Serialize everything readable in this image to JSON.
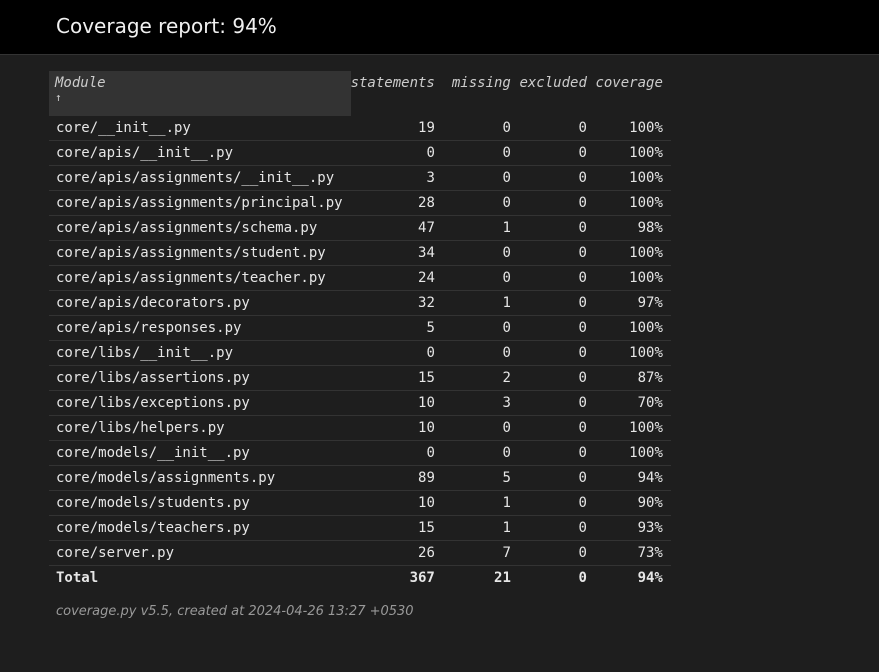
{
  "header": {
    "title": "Coverage report: 94%"
  },
  "table": {
    "columns": {
      "module": "Module",
      "sort_indicator": "↑",
      "statements": "statements",
      "missing": "missing",
      "excluded": "excluded",
      "coverage": "coverage"
    },
    "rows": [
      {
        "module": "core/__init__.py",
        "statements": "19",
        "missing": "0",
        "excluded": "0",
        "coverage": "100%"
      },
      {
        "module": "core/apis/__init__.py",
        "statements": "0",
        "missing": "0",
        "excluded": "0",
        "coverage": "100%"
      },
      {
        "module": "core/apis/assignments/__init__.py",
        "statements": "3",
        "missing": "0",
        "excluded": "0",
        "coverage": "100%"
      },
      {
        "module": "core/apis/assignments/principal.py",
        "statements": "28",
        "missing": "0",
        "excluded": "0",
        "coverage": "100%"
      },
      {
        "module": "core/apis/assignments/schema.py",
        "statements": "47",
        "missing": "1",
        "excluded": "0",
        "coverage": "98%"
      },
      {
        "module": "core/apis/assignments/student.py",
        "statements": "34",
        "missing": "0",
        "excluded": "0",
        "coverage": "100%"
      },
      {
        "module": "core/apis/assignments/teacher.py",
        "statements": "24",
        "missing": "0",
        "excluded": "0",
        "coverage": "100%"
      },
      {
        "module": "core/apis/decorators.py",
        "statements": "32",
        "missing": "1",
        "excluded": "0",
        "coverage": "97%"
      },
      {
        "module": "core/apis/responses.py",
        "statements": "5",
        "missing": "0",
        "excluded": "0",
        "coverage": "100%"
      },
      {
        "module": "core/libs/__init__.py",
        "statements": "0",
        "missing": "0",
        "excluded": "0",
        "coverage": "100%"
      },
      {
        "module": "core/libs/assertions.py",
        "statements": "15",
        "missing": "2",
        "excluded": "0",
        "coverage": "87%"
      },
      {
        "module": "core/libs/exceptions.py",
        "statements": "10",
        "missing": "3",
        "excluded": "0",
        "coverage": "70%"
      },
      {
        "module": "core/libs/helpers.py",
        "statements": "10",
        "missing": "0",
        "excluded": "0",
        "coverage": "100%"
      },
      {
        "module": "core/models/__init__.py",
        "statements": "0",
        "missing": "0",
        "excluded": "0",
        "coverage": "100%"
      },
      {
        "module": "core/models/assignments.py",
        "statements": "89",
        "missing": "5",
        "excluded": "0",
        "coverage": "94%"
      },
      {
        "module": "core/models/students.py",
        "statements": "10",
        "missing": "1",
        "excluded": "0",
        "coverage": "90%"
      },
      {
        "module": "core/models/teachers.py",
        "statements": "15",
        "missing": "1",
        "excluded": "0",
        "coverage": "93%"
      },
      {
        "module": "core/server.py",
        "statements": "26",
        "missing": "7",
        "excluded": "0",
        "coverage": "73%"
      }
    ],
    "total": {
      "label": "Total",
      "statements": "367",
      "missing": "21",
      "excluded": "0",
      "coverage": "94%"
    }
  },
  "footer": {
    "text": "coverage.py v5.5, created at 2024-04-26 13:27 +0530"
  }
}
